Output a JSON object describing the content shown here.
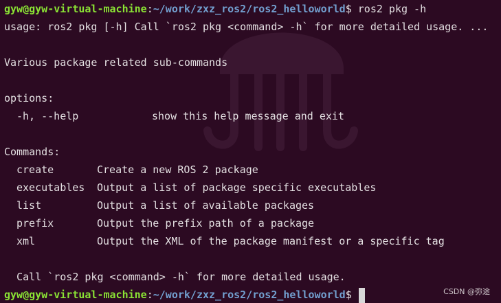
{
  "prompt": {
    "user_host": "gyw@gyw-virtual-machine",
    "colon": ":",
    "path": "~/work/zxz_ros2/ros2_helloworld",
    "symbol": "$",
    "command": " ros2 pkg -h"
  },
  "usage_line": "usage: ros2 pkg [-h] Call `ros2 pkg <command> -h` for more detailed usage. ...",
  "description": "Various package related sub-commands",
  "options_heading": "options:",
  "options": [
    {
      "flag": "-h, --help",
      "text": "show this help message and exit"
    }
  ],
  "commands_heading": "Commands:",
  "commands": [
    {
      "name": "create",
      "text": "Create a new ROS 2 package"
    },
    {
      "name": "executables",
      "text": "Output a list of package specific executables"
    },
    {
      "name": "list",
      "text": "Output a list of available packages"
    },
    {
      "name": "prefix",
      "text": "Output the prefix path of a package"
    },
    {
      "name": "xml",
      "text": "Output the XML of the package manifest or a specific tag"
    }
  ],
  "footer_line": "  Call `ros2 pkg <command> -h` for more detailed usage.",
  "watermark": "CSDN @弥途",
  "colors": {
    "background": "#2c0a22",
    "user_host": "#8ae234",
    "path": "#729fcf",
    "text": "#e4e0e2"
  },
  "icons": {
    "background_logo": "ros-jellyfish-logo-icon",
    "cursor": "block-cursor-icon"
  }
}
